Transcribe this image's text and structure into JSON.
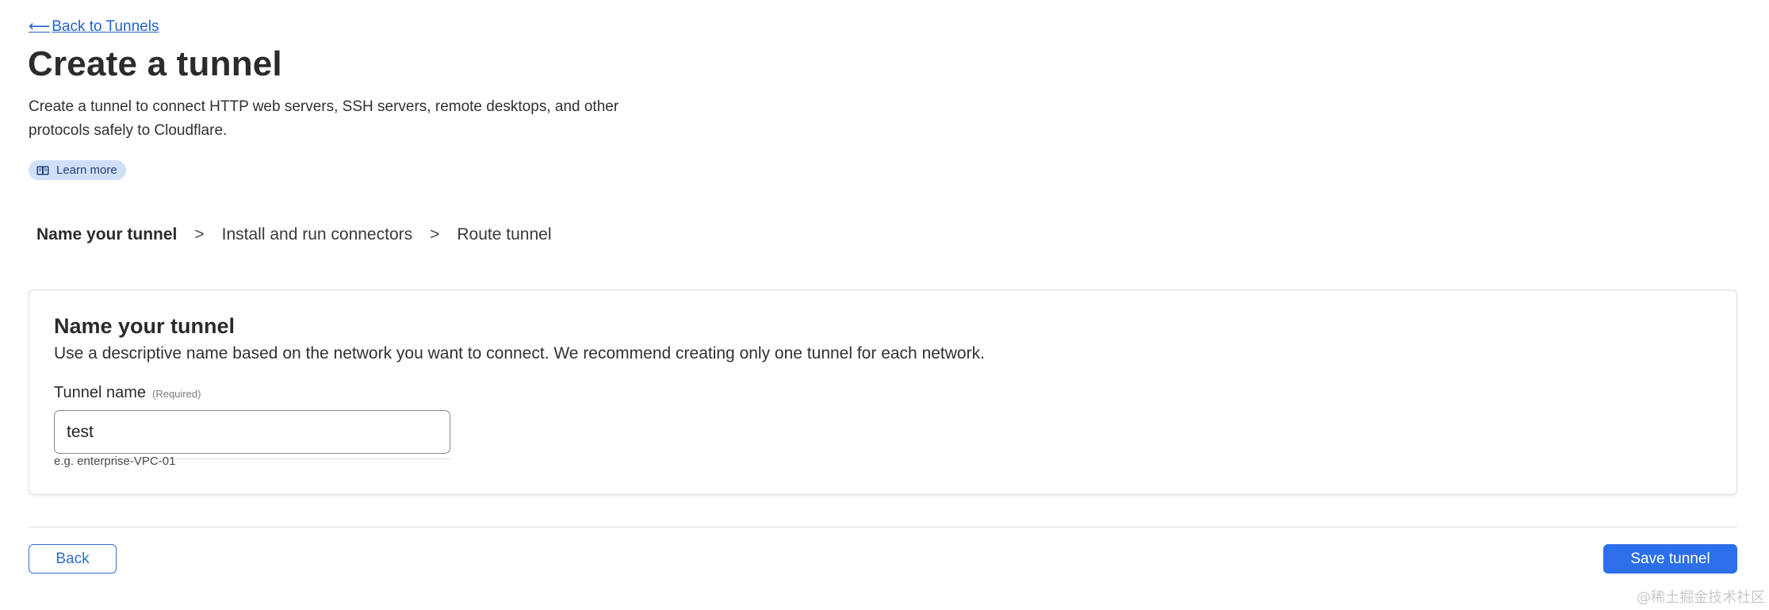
{
  "header": {
    "back_link": "Back to Tunnels",
    "title": "Create a tunnel",
    "description": "Create a tunnel to connect HTTP web servers, SSH servers, remote desktops, and other protocols safely to Cloudflare.",
    "learn_more": "Learn more"
  },
  "steps": [
    {
      "label": "Name your tunnel",
      "active": true
    },
    {
      "label": "Install and run connectors",
      "active": false
    },
    {
      "label": "Route tunnel",
      "active": false
    }
  ],
  "step_separator": ">",
  "card": {
    "title": "Name your tunnel",
    "description": "Use a descriptive name based on the network you want to connect. We recommend creating only one tunnel for each network.",
    "field_label": "Tunnel name",
    "field_required": "(Required)",
    "field_value": "test",
    "field_hint": "e.g. enterprise-VPC-01"
  },
  "footer": {
    "back_button": "Back",
    "save_button": "Save tunnel"
  },
  "watermark": "@稀土掘金技术社区",
  "icons": {
    "back_arrow": "left-arrow-icon",
    "learn_more": "book-icon"
  },
  "colors": {
    "accent": "#2c6fe8",
    "link": "#2563c9",
    "pill_bg": "#cfe0f8"
  }
}
